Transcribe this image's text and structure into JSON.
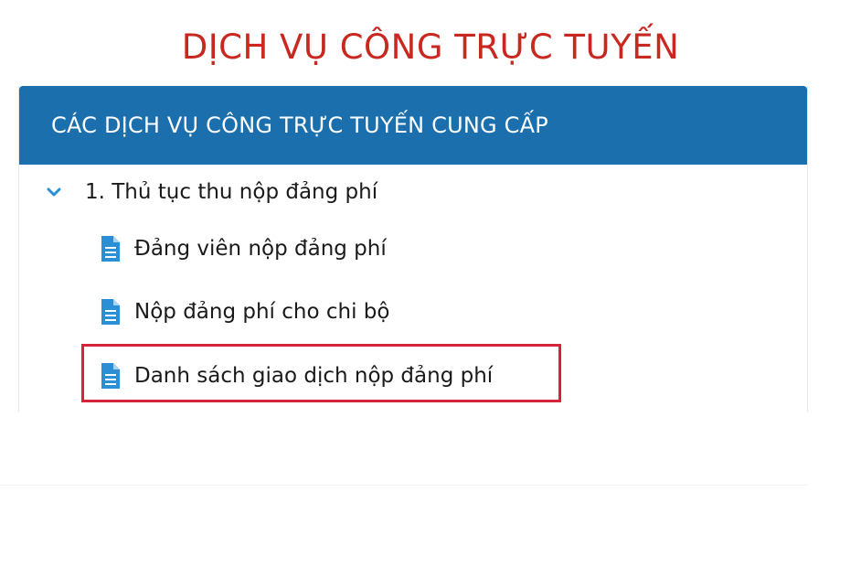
{
  "page": {
    "title": "DỊCH VỤ CÔNG TRỰC TUYẾN"
  },
  "panel": {
    "header": "CÁC DỊCH VỤ CÔNG TRỰC TUYẾN CUNG CẤP",
    "group": {
      "label": "1. Thủ tục thu nộp đảng phí",
      "expanded": true,
      "icon": "chevron-down-icon",
      "items": [
        {
          "label": "Đảng viên nộp đảng phí",
          "icon": "document-icon"
        },
        {
          "label": "Nộp đảng phí cho chi bộ",
          "icon": "document-icon"
        },
        {
          "label": "Danh sách giao dịch nộp đảng phí",
          "icon": "document-icon",
          "highlighted": true
        }
      ]
    }
  },
  "colors": {
    "title": "#c8281f",
    "header_bg": "#1b6fad",
    "header_text": "#ffffff",
    "icon_blue": "#2b8fd6",
    "highlight_border": "#d3243a"
  }
}
